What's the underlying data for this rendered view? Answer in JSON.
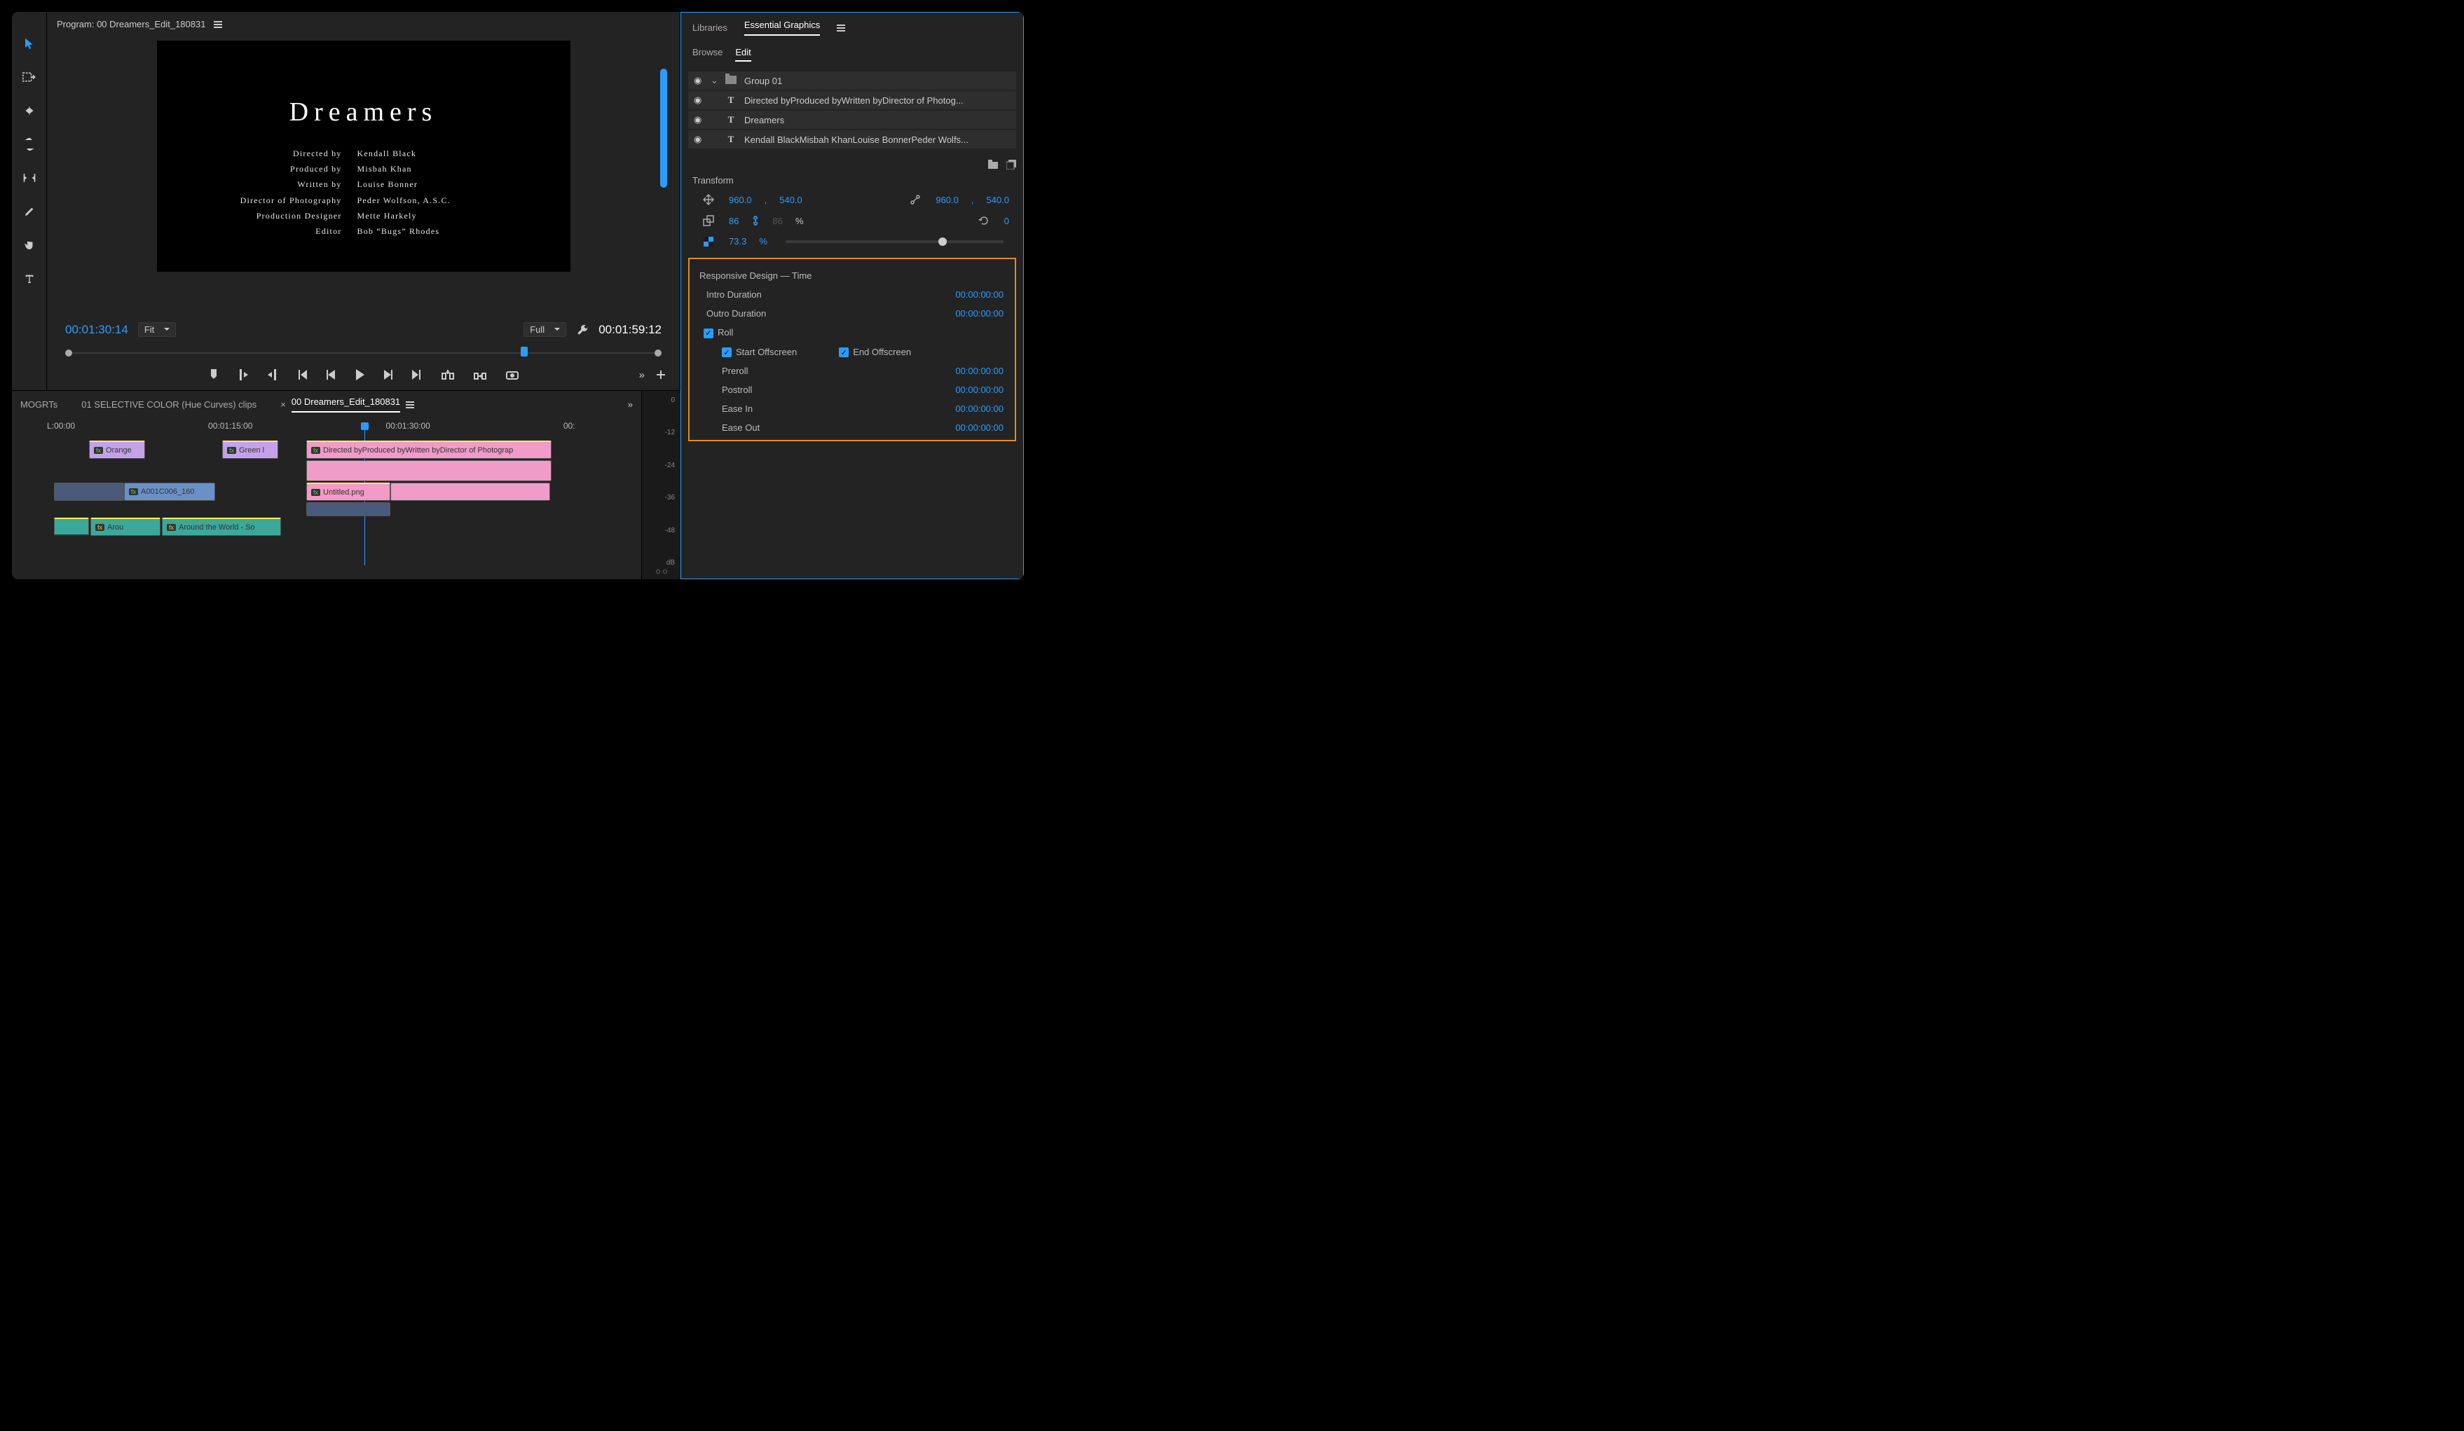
{
  "program": {
    "title": "Program: 00 Dreamers_Edit_180831",
    "tc_in": "00:01:30:14",
    "tc_out": "00:01:59:12",
    "fit_label": "Fit",
    "resolution_label": "Full"
  },
  "preview": {
    "title": "Dreamers",
    "credits": [
      {
        "role": "Directed by",
        "name": "Kendall Black"
      },
      {
        "role": "Produced by",
        "name": "Misbah Khan"
      },
      {
        "role": "Written by",
        "name": "Louise Bonner"
      },
      {
        "role": "Director of Photography",
        "name": "Peder Wolfson, A.S.C."
      },
      {
        "role": "Production Designer",
        "name": "Mette Harkely"
      },
      {
        "role": "Editor",
        "name": "Bob “Bugs” Rhodes"
      }
    ]
  },
  "timeline": {
    "tabs": [
      "MOGRTs",
      "01 SELECTIVE COLOR (Hue Curves) clips"
    ],
    "active_tab": "00 Dreamers_Edit_180831",
    "ruler": [
      "L:00:00",
      "00:01:15:00",
      "00:01:30:00",
      "00:"
    ],
    "clips": {
      "orange": "Orange",
      "green": "Green l",
      "directed": "Directed byProduced byWritten byDirector of Photograp",
      "a001": "A001C006_160",
      "untitled": "Untitled.png",
      "around1": "Arou",
      "around2": "Around the World - So"
    }
  },
  "audio_scale": [
    "0",
    "-12",
    "-24",
    "-36",
    "-48",
    "dB"
  ],
  "right": {
    "tabs": [
      "Libraries",
      "Essential Graphics"
    ],
    "sub_tabs": [
      "Browse",
      "Edit"
    ],
    "layers": [
      {
        "type": "group",
        "label": "Group 01"
      },
      {
        "type": "text",
        "label": "Directed byProduced byWritten byDirector of Photog..."
      },
      {
        "type": "text",
        "label": "Dreamers"
      },
      {
        "type": "text",
        "label": "Kendall BlackMisbah KhanLouise BonnerPeder Wolfs..."
      }
    ],
    "transform": {
      "title": "Transform",
      "pos_x": "960.0",
      "pos_y": "540.0",
      "anc_x": "960.0",
      "anc_y": "540.0",
      "scale": "86",
      "scale_locked": "86",
      "pct": "%",
      "rotation": "0",
      "opacity": "73.3",
      "opacity_pct": "%"
    },
    "responsive": {
      "title": "Responsive Design — Time",
      "intro_label": "Intro Duration",
      "intro": "00:00:00:00",
      "outro_label": "Outro Duration",
      "outro": "00:00:00:00",
      "roll_label": "Roll",
      "start_off_label": "Start Offscreen",
      "end_off_label": "End Offscreen",
      "preroll_label": "Preroll",
      "preroll": "00:00:00:00",
      "postroll_label": "Postroll",
      "postroll": "00:00:00:00",
      "easein_label": "Ease In",
      "easein": "00:00:00:00",
      "easeout_label": "Ease Out",
      "easeout": "00:00:00:00"
    }
  }
}
